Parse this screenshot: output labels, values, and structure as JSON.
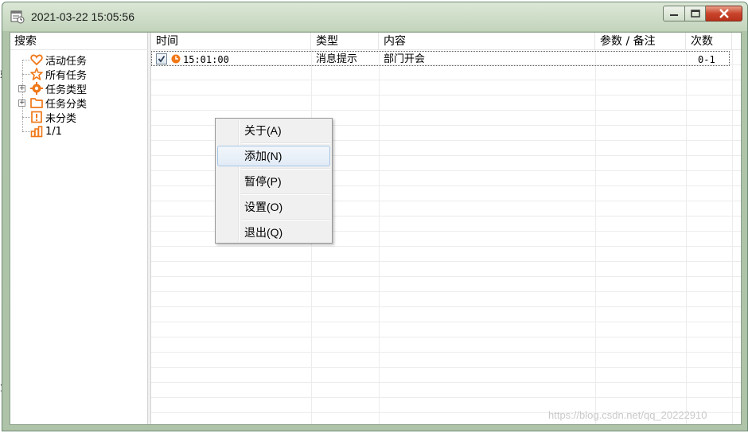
{
  "window": {
    "title": "2021-03-22 15:05:56",
    "controls": {
      "minimize": "minimize",
      "maximize": "maximize",
      "close": "close"
    }
  },
  "tree": {
    "header": "搜索",
    "items": [
      {
        "label": "活动任务",
        "icon": "heart-icon",
        "color": "#f07818",
        "expandable": false
      },
      {
        "label": "所有任务",
        "icon": "star-icon",
        "color": "#f07818",
        "expandable": false
      },
      {
        "label": "任务类型",
        "icon": "gear-icon",
        "color": "#f07818",
        "expandable": true
      },
      {
        "label": "任务分类",
        "icon": "folder-icon",
        "color": "#f07818",
        "expandable": true
      },
      {
        "label": "未分类",
        "icon": "exclamation-icon",
        "color": "#f07818",
        "expandable": false
      },
      {
        "label": "1/1",
        "icon": "bar-chart-icon",
        "color": "#f07818",
        "expandable": false
      }
    ]
  },
  "list": {
    "columns": [
      "时间",
      "类型",
      "内容",
      "参数 / 备注",
      "次数"
    ],
    "rows": [
      {
        "checked": true,
        "time": "15:01:00",
        "type": "消息提示",
        "content": "部门开会",
        "params": "",
        "count": "0-1"
      }
    ]
  },
  "context_menu": {
    "items": [
      {
        "label": "关于(A)",
        "highlighted": false
      },
      {
        "label": "添加(N)",
        "highlighted": true
      },
      {
        "label": "暂停(P)",
        "highlighted": false
      },
      {
        "label": "设置(O)",
        "highlighted": false
      },
      {
        "label": "退出(Q)",
        "highlighted": false
      }
    ]
  },
  "watermark": "https://blog.csdn.net/qq_20222910",
  "colors": {
    "accent": "#f07818",
    "title_bar": "#c3d4bc",
    "menu_highlight_border": "#a8c6e8",
    "close_button": "#c9442b"
  }
}
